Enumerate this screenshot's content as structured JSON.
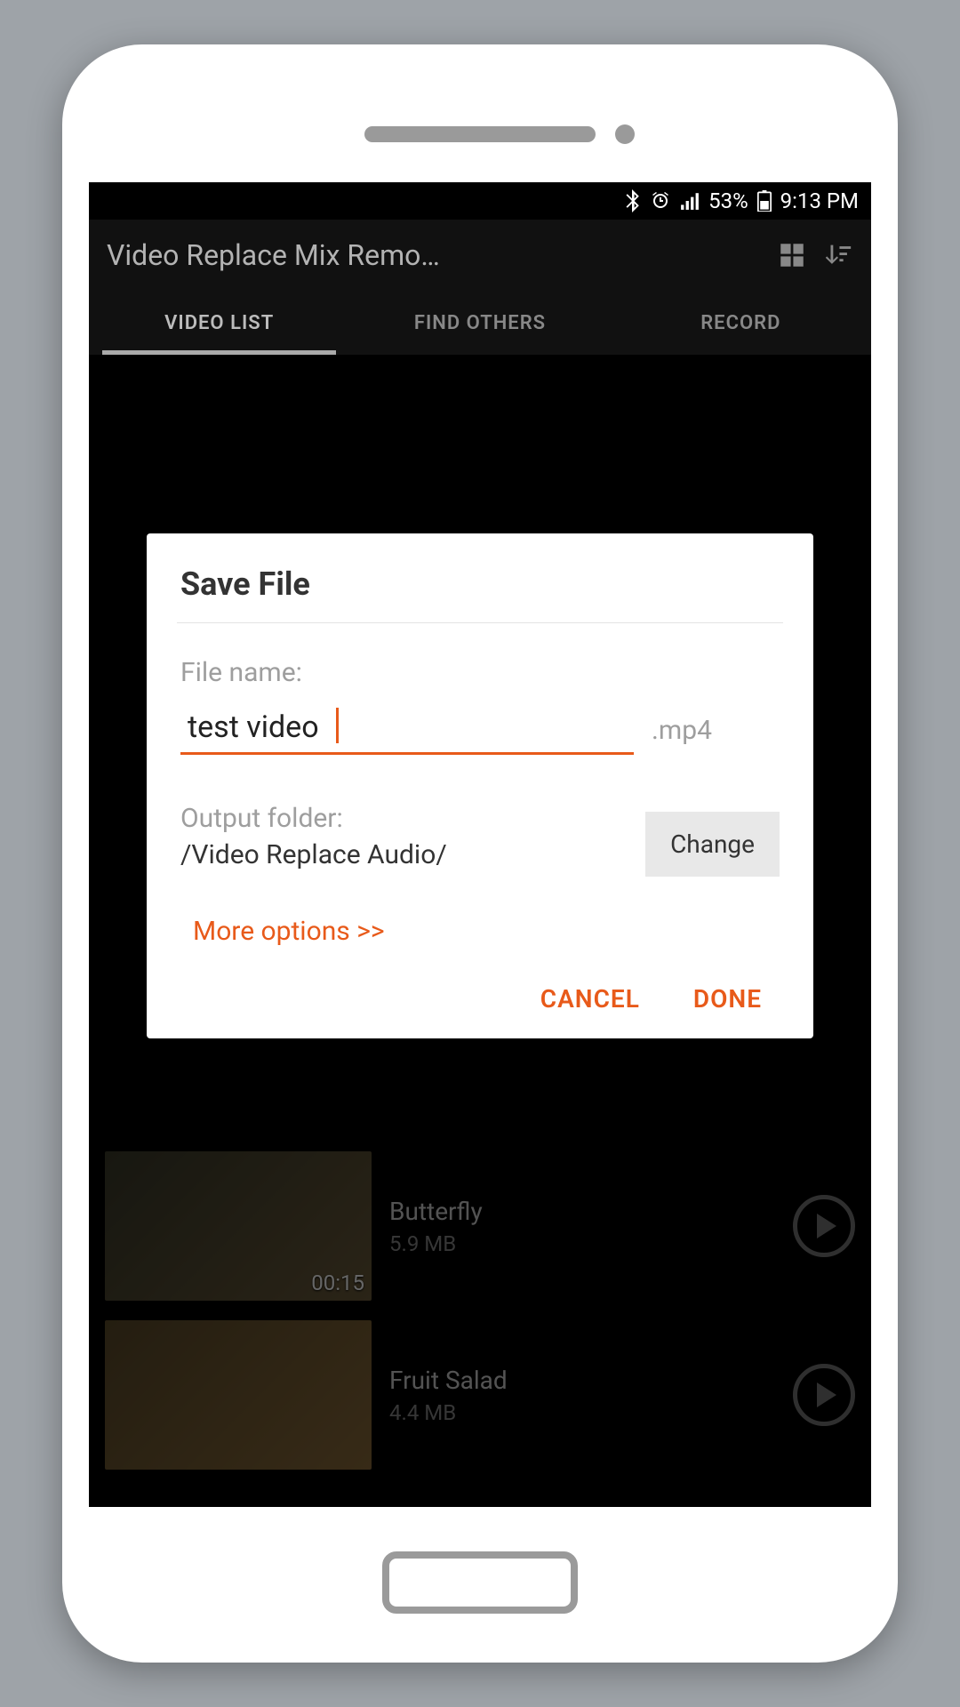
{
  "status_bar": {
    "battery_pct": "53%",
    "time": "9:13 PM"
  },
  "header": {
    "title": "Video Replace Mix Remo…"
  },
  "tabs": [
    {
      "label": "VIDEO LIST",
      "active": true
    },
    {
      "label": "FIND OTHERS",
      "active": false
    },
    {
      "label": "RECORD",
      "active": false
    }
  ],
  "dialog": {
    "title": "Save File",
    "filename_label": "File name:",
    "filename_value": "test video",
    "extension": ".mp4",
    "output_label": "Output folder:",
    "output_path": "/Video Replace Audio/",
    "change_label": "Change",
    "more_options": "More options >>",
    "cancel": "CANCEL",
    "done": "DONE"
  },
  "videos": [
    {
      "name": "Butterfly",
      "size": "5.9 MB",
      "duration": "00:15"
    },
    {
      "name": "Fruit Salad",
      "size": "4.4 MB",
      "duration": ""
    }
  ]
}
